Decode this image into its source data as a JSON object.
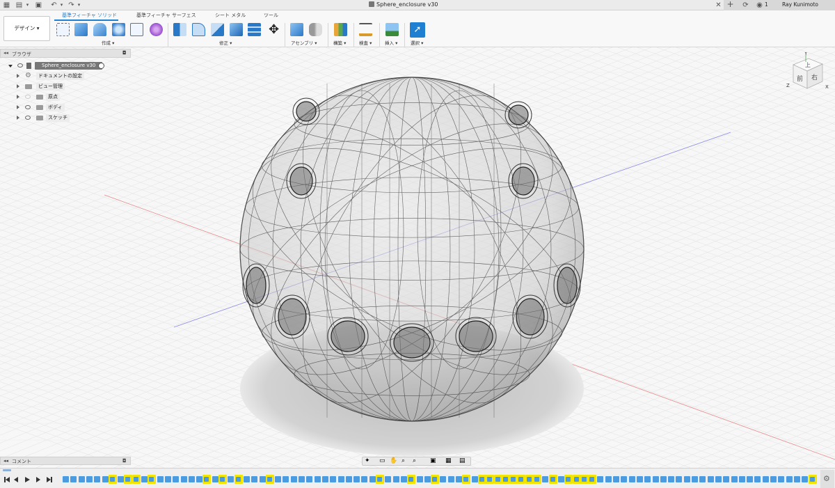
{
  "window": {
    "title": "Sphere_enclosure v30",
    "user": "Ray Kunimoto",
    "job_count": "1"
  },
  "ribbon": {
    "workspace": "デザイン ▾",
    "tabs": [
      "基準フィーチャ ソリッド",
      "基準フィーチャ サーフェス",
      "シート メタル",
      "ツール"
    ],
    "active_tab": 0,
    "groups": [
      "作成 ▾",
      "修正 ▾",
      "アセンブリ ▾",
      "構築 ▾",
      "検査 ▾",
      "挿入 ▾",
      "選択 ▾"
    ]
  },
  "browser": {
    "header": "ブラウザ",
    "root": "Sphere_enclosure v30",
    "items": [
      "ドキュメントの設定",
      "ビュー管理",
      "原点",
      "ボディ",
      "スケッチ"
    ]
  },
  "viewcube": {
    "faces": [
      "上",
      "前",
      "右"
    ],
    "axes": [
      "Y",
      "Z",
      "X"
    ]
  },
  "comments": {
    "label": "コメント"
  },
  "colors": {
    "accent": "#1f7fd1",
    "timeline_highlight": "#f2e600",
    "timeline_error": "#e0323c",
    "feature_blue": "#4a9be0"
  },
  "icons": {
    "grid": "apps-grid-icon",
    "file": "file-icon",
    "save": "save-icon",
    "undo": "undo-icon",
    "redo": "redo-icon",
    "close": "close-icon",
    "add": "add-tab-icon",
    "jobs": "job-status-icon",
    "settings": "gear-icon"
  }
}
